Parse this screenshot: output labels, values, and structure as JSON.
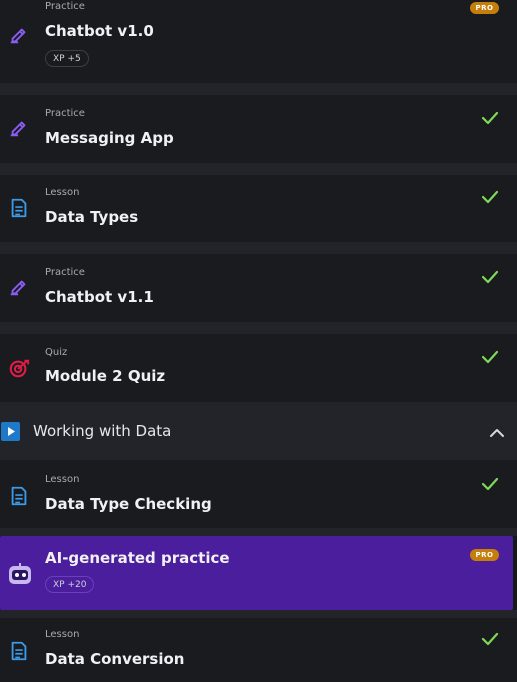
{
  "items": [
    {
      "kind": "Practice",
      "title": "Chatbot v1.0",
      "pro": "PRO",
      "xp": "XP +5"
    },
    {
      "kind": "Practice",
      "title": "Messaging App"
    },
    {
      "kind": "Lesson",
      "title": "Data Types"
    },
    {
      "kind": "Practice",
      "title": "Chatbot v1.1"
    },
    {
      "kind": "Quiz",
      "title": "Module 2 Quiz"
    }
  ],
  "section": {
    "title": "Working with Data"
  },
  "items2": [
    {
      "kind": "Lesson",
      "title": "Data Type Checking"
    },
    {
      "title": "AI-generated practice",
      "pro": "PRO",
      "xp": "XP +20"
    },
    {
      "kind": "Lesson",
      "title": "Data Conversion"
    }
  ],
  "colors": {
    "background": "#17181b",
    "card": "#1a1b1f",
    "check": "#7ed957",
    "pro": "#c67e0b",
    "ai_card": "#4a1e9c",
    "practice_icon": "#8b5cf6",
    "lesson_icon": "#3b9be8",
    "quiz_icon": "#e11d48"
  },
  "icons": {
    "practice": "pencil-icon",
    "lesson": "document-icon",
    "quiz": "target-icon",
    "done": "checkmark-icon",
    "section": "play-icon",
    "collapse": "chevron-up-icon",
    "ai": "robot-icon"
  }
}
